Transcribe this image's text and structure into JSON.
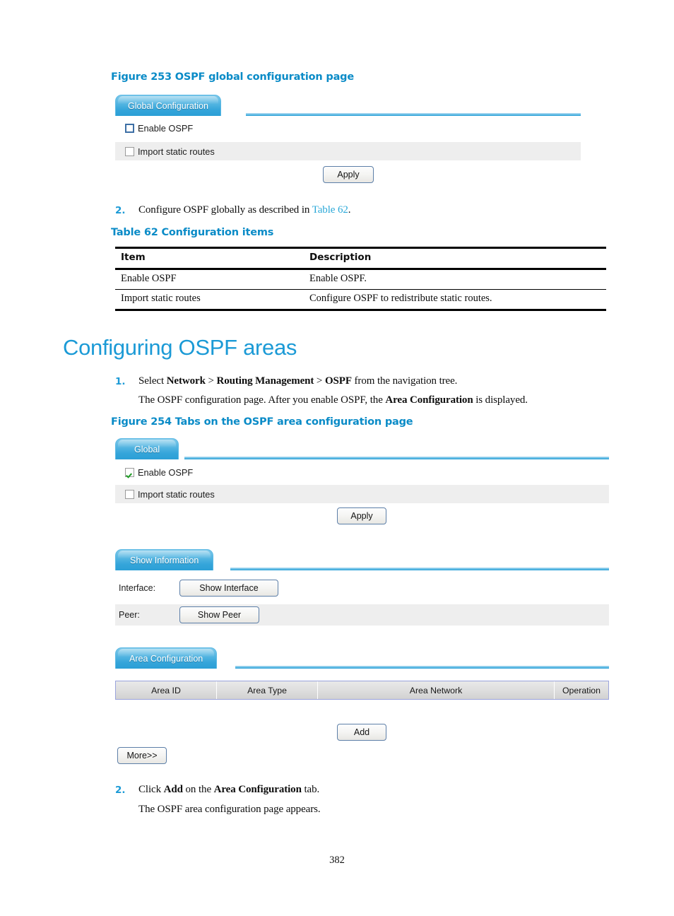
{
  "document": {
    "page_number": "382",
    "heading": "Configuring OSPF areas"
  },
  "figure253": {
    "caption": "Figure 253 OSPF global configuration page",
    "tab_label": "Global Configuration",
    "checkbox_enable_ospf": "Enable OSPF",
    "checkbox_import_static_routes": "Import static routes",
    "apply_button": "Apply"
  },
  "step_configure": {
    "number": "2.",
    "text_before": "Configure OSPF globally as described in ",
    "link": "Table 62",
    "text_after": "."
  },
  "table62": {
    "caption": "Table 62 Configuration items",
    "headers": [
      "Item",
      "Description"
    ],
    "rows": [
      [
        "Enable OSPF",
        "Enable OSPF."
      ],
      [
        "Import static routes",
        "Configure OSPF to redistribute static routes."
      ]
    ]
  },
  "step1": {
    "number": "1.",
    "line1": {
      "p1": "Select ",
      "b1": "Network",
      "p2": " > ",
      "b2": "Routing Management",
      "p3": " > ",
      "b3": "OSPF",
      "p4": " from the navigation tree."
    },
    "line2": {
      "p1": "The OSPF configuration page. After you enable OSPF, the ",
      "b1": "Area Configuration",
      "p2": " is displayed."
    }
  },
  "figure254": {
    "caption": "Figure 254 Tabs on the OSPF area configuration page",
    "global_panel": {
      "tab_label": "Global",
      "checkbox_enable_ospf": "Enable OSPF",
      "checkbox_import_static_routes": "Import static routes",
      "apply_button": "Apply"
    },
    "show_information_panel": {
      "tab_label": "Show Information",
      "interface_label": "Interface:",
      "show_interface_button": "Show Interface",
      "peer_label": "Peer:",
      "show_peer_button": "Show Peer"
    },
    "area_configuration_panel": {
      "tab_label": "Area Configuration",
      "grid_headers": [
        "Area ID",
        "Area Type",
        "Area Network",
        "Operation"
      ],
      "add_button": "Add",
      "more_button": "More>>"
    }
  },
  "step2_final": {
    "number": "2.",
    "line1": {
      "p1": "Click ",
      "b1": "Add",
      "p2": " on the ",
      "b2": "Area Configuration",
      "p3": " tab."
    },
    "line2": "The OSPF area configuration page appears."
  },
  "colors": {
    "heading_blue": "#1b9ad6",
    "caption_blue": "#0a8bc7",
    "tab_blue": "#35a5da",
    "check_green": "#1f9c25",
    "grid_border": "#9aa3dc"
  }
}
